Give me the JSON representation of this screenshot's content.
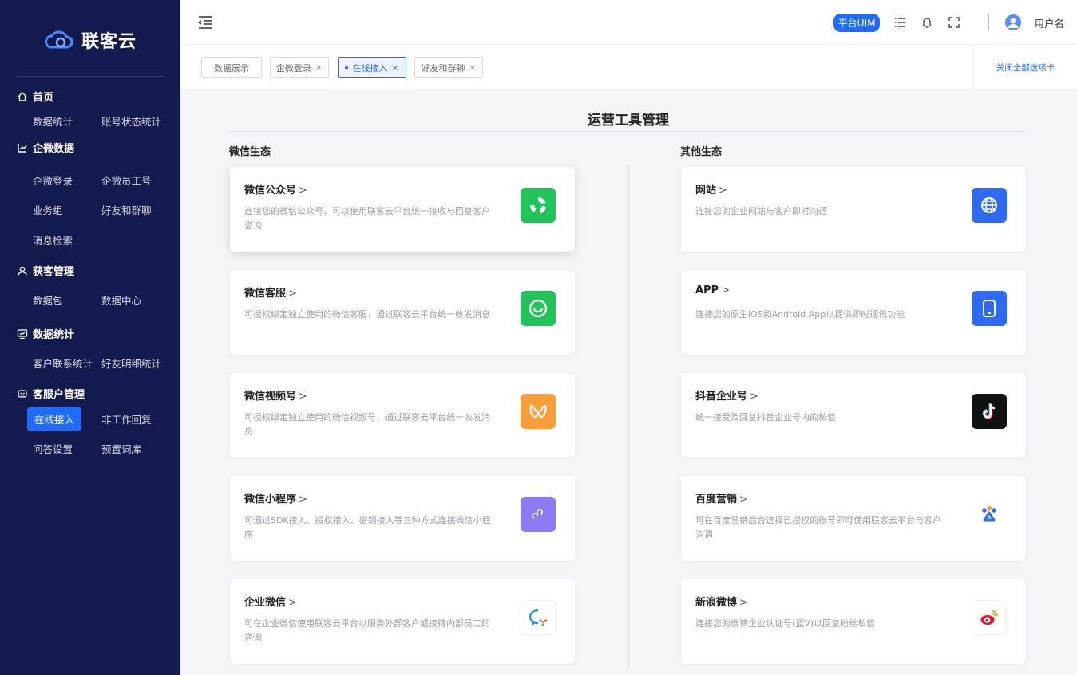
{
  "brand": {
    "name": "联客云"
  },
  "sidebar": {
    "sections": [
      {
        "title": "首页",
        "icon": "home-icon",
        "items": [
          "数据统计",
          "账号状态统计"
        ]
      },
      {
        "title": "企微数据",
        "icon": "line-chart-icon",
        "items": [
          "企微登录",
          "企微员工号",
          "业务组",
          "好友和群聊",
          "消息检索"
        ]
      },
      {
        "title": "获客管理",
        "icon": "user-icon",
        "items": [
          "数据包",
          "数据中心"
        ]
      },
      {
        "title": "数据统计",
        "icon": "monitor-chart-icon",
        "items": [
          "客户联系统计",
          "好友明细统计"
        ]
      },
      {
        "title": "客服户管理",
        "icon": "robot-face-icon",
        "items": [
          "在线接入",
          "非工作回复",
          "问答设置",
          "预置词库"
        ]
      }
    ],
    "active_item": "在线接入"
  },
  "header": {
    "badge": "平台UIM",
    "username": "用户名"
  },
  "tabs": {
    "items": [
      "数据展示",
      "企微登录",
      "在线接入",
      "好友和群聊"
    ],
    "active_index": 2,
    "close_all": "关闭全部选项卡"
  },
  "main": {
    "title": "运营工具管理",
    "left_column": {
      "title": "微信生态",
      "cards": [
        {
          "title": "微信公众号",
          "desc": "连接您的微信公众号，可以使用联客云平台统一接收与回复客户咨询",
          "icon": "wechat-official-account-icon",
          "color": "#21c35a"
        },
        {
          "title": "微信客服",
          "desc": "可授权绑定独立使用的微信客服，通过联客云平台统一收发消息",
          "icon": "wechat-service-icon",
          "color": "#21c35a"
        },
        {
          "title": "微信视频号",
          "desc": "可授权绑定独立使用的微信视频号，通过联客云平台统一收发消息",
          "icon": "wechat-channels-icon",
          "color": "#fa9d3b"
        },
        {
          "title": "微信小程序",
          "desc": "可通过SDK接入、授权接入、密钥接入等三种方式连接微信小程序",
          "icon": "mini-program-icon",
          "color": "#8b7cf6"
        },
        {
          "title": "企业微信",
          "desc": "可在企业微信使用联客云平台以服务外部客户或接待内部员工的咨询",
          "icon": "wecom-icon",
          "color": "#ffffff"
        }
      ]
    },
    "right_column": {
      "title": "其他生态",
      "cards": [
        {
          "title": "网站",
          "desc": "连接您的企业网站与客户即时沟通",
          "icon": "globe-icon",
          "color": "#2f6bf2"
        },
        {
          "title": "APP",
          "desc": "连接您的原生iOS和Android App以提供即时通讯功能",
          "icon": "mobile-app-icon",
          "color": "#2f6bf2"
        },
        {
          "title": "抖音企业号",
          "desc": "统一接受及回复抖音企业号内的私信",
          "icon": "douyin-icon",
          "color": "#111111"
        },
        {
          "title": "百度营销",
          "desc": "可在百度营销后台选择已授权的账号即可使用联客云平台与客户沟通",
          "icon": "baidu-paw-icon",
          "color": "#ffffff"
        },
        {
          "title": "新浪微博",
          "desc": "连接您的微博企业认证号(蓝V)以回复粉丝私信",
          "icon": "weibo-icon",
          "color": "#ffffff"
        }
      ]
    }
  }
}
